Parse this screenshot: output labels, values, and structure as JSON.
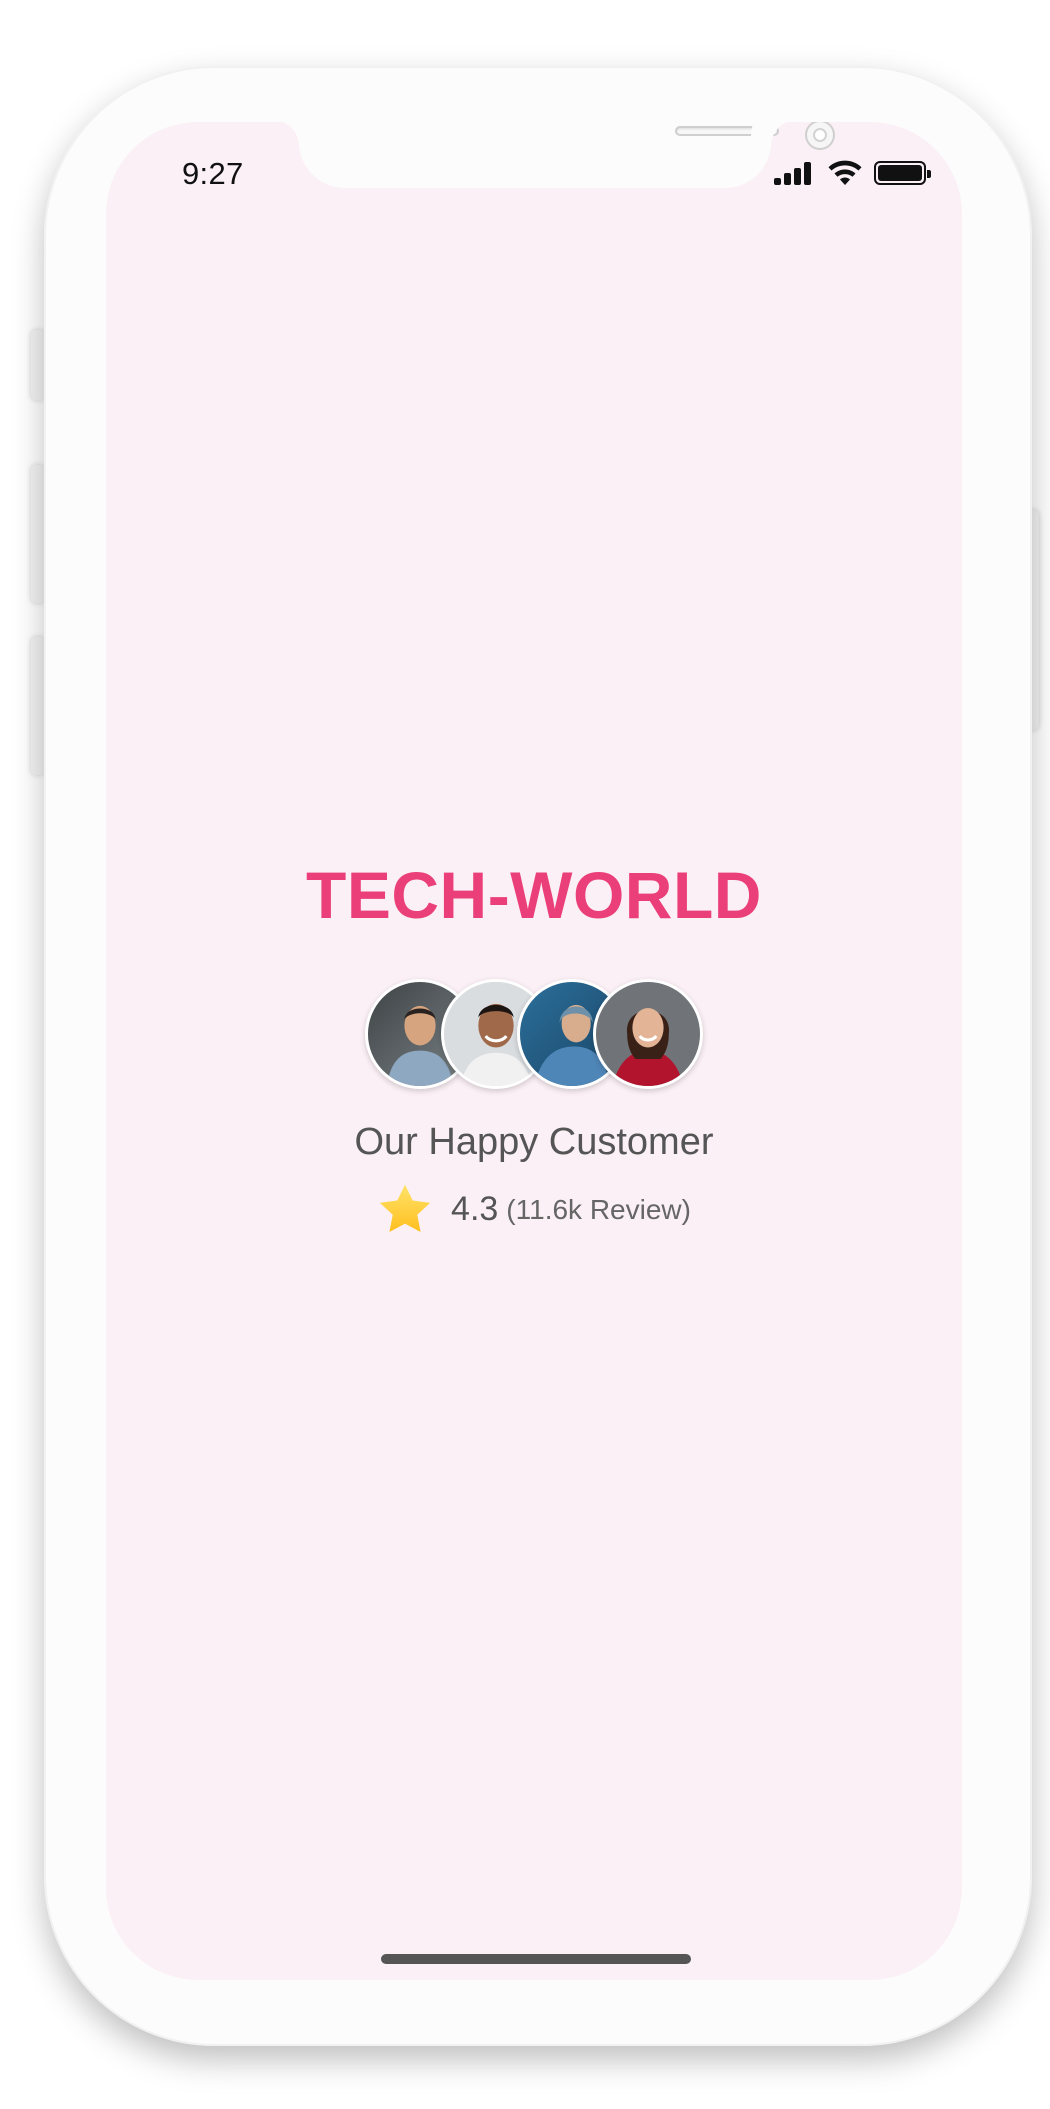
{
  "status_bar": {
    "time": "9:27",
    "battery_level": 1.0
  },
  "app": {
    "brand": "TECH-WORLD",
    "caption": "Our Happy Customer",
    "rating": {
      "value": "4.3",
      "count_text": "(11.6k Review)"
    },
    "avatars": [
      {
        "name": "customer-1"
      },
      {
        "name": "customer-2"
      },
      {
        "name": "customer-3"
      },
      {
        "name": "customer-4"
      }
    ]
  },
  "colors": {
    "brand": "#ea3f78",
    "screen_bg": "#fbf0f5",
    "text": "#555555",
    "star": "#ffcf3f"
  },
  "icons": {
    "signal": "signal-icon",
    "wifi": "wifi-icon",
    "battery": "battery-icon",
    "star": "star-icon"
  }
}
